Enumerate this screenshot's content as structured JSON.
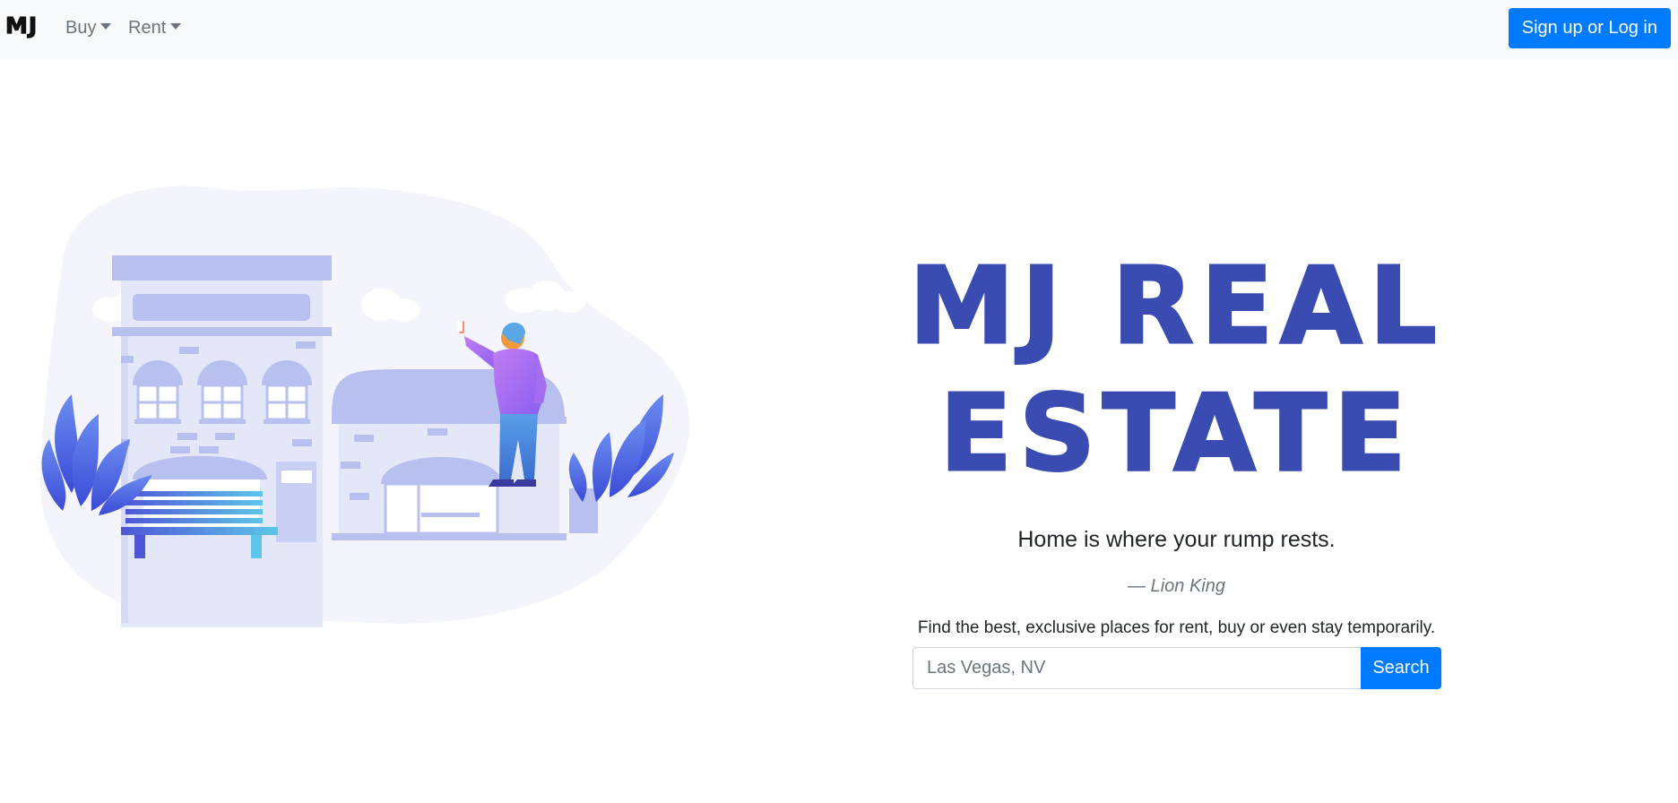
{
  "navbar": {
    "brand": "MJ",
    "menu": [
      {
        "label": "Buy"
      },
      {
        "label": "Rent"
      }
    ],
    "login_button": "Sign up or Log in"
  },
  "hero": {
    "title_line1": "MJ REAL",
    "title_line2": "ESTATE",
    "tagline": "Home is where your rump rests.",
    "quote_attribution": "— Lion King",
    "subtitle": "Find the best, exclusive places for rent, buy or even stay temporarily."
  },
  "search": {
    "placeholder": "Las Vegas, NV",
    "button_label": "Search"
  },
  "colors": {
    "primary": "#007bff",
    "title": "#3a4bb1",
    "navbar_bg": "#f8f9fa",
    "muted": "#6c757d"
  }
}
